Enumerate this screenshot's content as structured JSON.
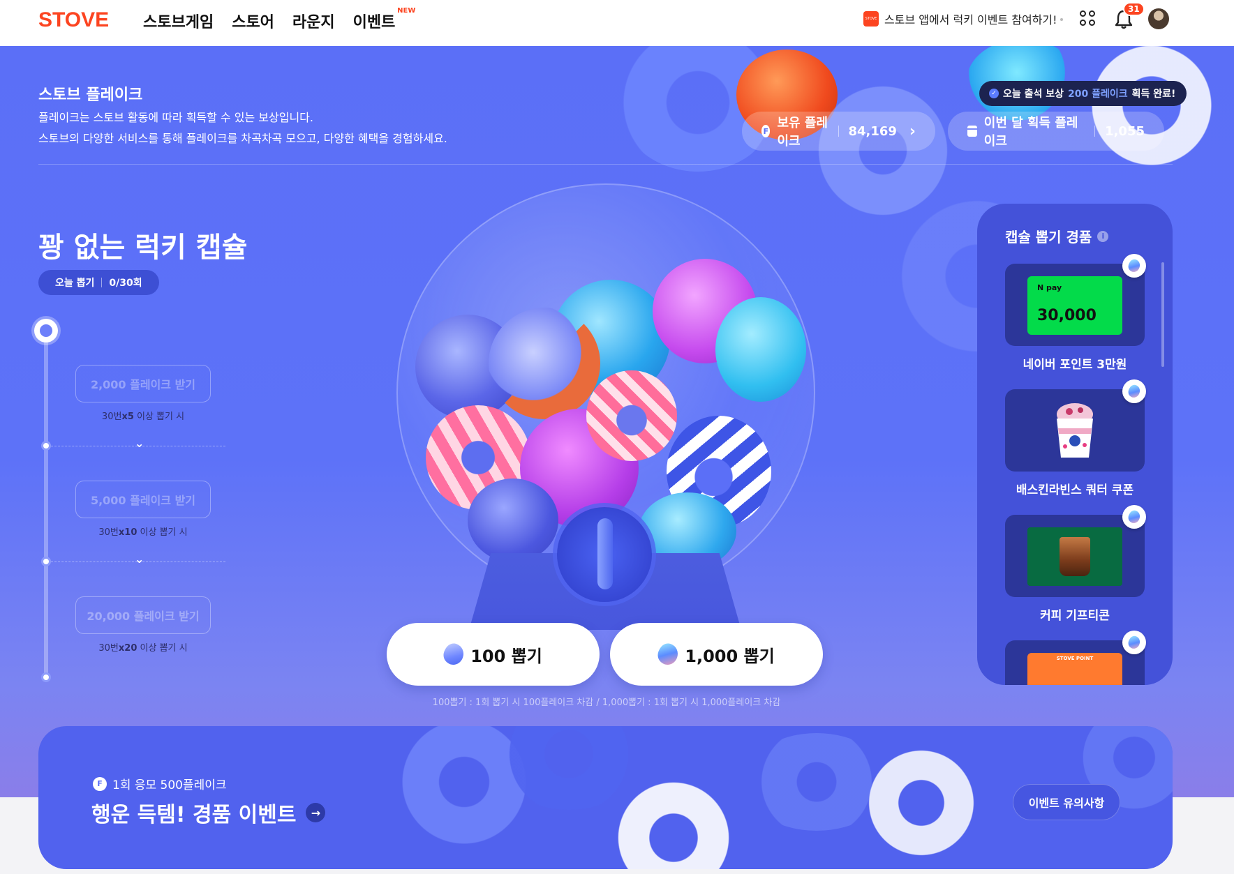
{
  "nav": {
    "logo": "STOVE",
    "items": [
      "스토브게임",
      "스토어",
      "라운지",
      "이벤트"
    ],
    "new_badge": "NEW",
    "promo_logo": "STOVE",
    "promo_text": "스토브 앱에서 럭키 이벤트 참여하기!",
    "notification_count": "31",
    "icons": [
      "apps-grid-icon",
      "bell-icon",
      "avatar"
    ]
  },
  "flake": {
    "title": "스토브 플레이크",
    "desc_line1": "플레이크는 스토브 활동에 따라 획득할 수 있는 보상입니다.",
    "desc_line2": "스토브의 다양한 서비스를 통해 플레이크를 차곡차곡 모으고, 다양한 혜택을 경험하세요.",
    "attendance_prefix": "오늘 출석 보상",
    "attendance_amount": "200 플레이크",
    "attendance_suffix": "획득 완료!",
    "owned_label": "보유 플레이크",
    "owned_value": "84,169",
    "monthly_label": "이번 달 획득 플레이크",
    "monthly_value": "1,055",
    "f_icon": "F"
  },
  "capsule": {
    "title": "꽝 없는 럭키 캡슐",
    "daily_label": "오늘 뽑기",
    "daily_value": "0/30회",
    "rewards": [
      {
        "button": "2,000 플레이크 받기",
        "cond_pre": "30번",
        "cond_mult": "x5",
        "cond_post": " 이상 뽑기 시"
      },
      {
        "button": "5,000 플레이크 받기",
        "cond_pre": "30번",
        "cond_mult": "x10",
        "cond_post": " 이상 뽑기 시"
      },
      {
        "button": "20,000 플레이크 받기",
        "cond_pre": "30번",
        "cond_mult": "x20",
        "cond_post": " 이상 뽑기 시"
      }
    ],
    "draw_100": "100 뽑기",
    "draw_1000": "1,000 뽑기",
    "draw_note": "100뽑기 : 1회 뽑기 시 100플레이크 차감 / 1,000뽑기 : 1회 뽑기 시 1,000플레이크 차감"
  },
  "prizes": {
    "title": "캡슐 뽑기 경품",
    "items": [
      {
        "label": "네이버 포인트 3만원",
        "card_logo": "N pay",
        "card_amount": "30,000"
      },
      {
        "label": "배스킨라빈스 쿼터 쿠폰"
      },
      {
        "label": "커피 기프티콘"
      },
      {
        "label": "",
        "card_text": "STOVE POINT"
      }
    ]
  },
  "event": {
    "sub": "1회 응모 500플레이크",
    "title": "행운 득템! 경품 이벤트",
    "notice_button": "이벤트 유의사항"
  },
  "colors": {
    "brand": "#fc4420",
    "hero_bg": "#5b6ff7",
    "panel_bg": "#4452d9",
    "badge_dark": "#1c2350"
  }
}
